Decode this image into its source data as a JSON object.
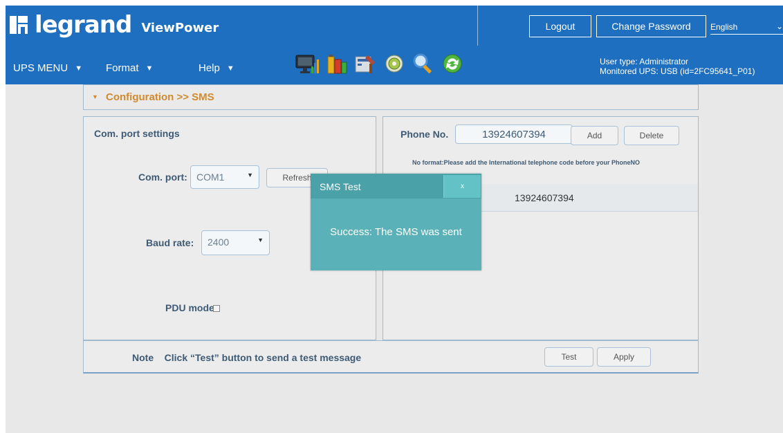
{
  "header": {
    "brand": "legrand",
    "product": "ViewPower",
    "logout_label": "Logout",
    "change_password_label": "Change Password",
    "language": "English",
    "user_type": "User type: Administrator",
    "monitored_ups": "Monitored UPS: USB (id=2FC95641_P01)"
  },
  "menus": [
    {
      "label": "UPS MENU"
    },
    {
      "label": "Format"
    },
    {
      "label": "Help"
    }
  ],
  "toolbar_icons": [
    "monitor-chart-icon",
    "batteries-icon",
    "tools-icon",
    "settings-disc-icon",
    "magnifier-icon",
    "refresh-arrows-icon"
  ],
  "breadcrumb": {
    "text": "Configuration >> SMS"
  },
  "com_settings": {
    "title": "Com. port settings",
    "com_port_label": "Com. port:",
    "com_port_value": "COM1",
    "refresh_label": "Refresh",
    "baud_label": "Baud rate:",
    "baud_value": "2400",
    "pdu_label": "PDU mode"
  },
  "phone": {
    "label": "Phone No.",
    "input_value": "13924607394",
    "add_label": "Add",
    "delete_label": "Delete",
    "format_note": "No format:Please add the International telephone code before your PhoneNO",
    "list": [
      "13924607394"
    ]
  },
  "footer": {
    "note": "Note    Click “Test” button to send a test message",
    "test_label": "Test",
    "apply_label": "Apply"
  },
  "modal": {
    "title": "SMS Test",
    "close_label": "x",
    "message": "Success: The SMS was sent"
  },
  "colors": {
    "header_bg": "#1e6fc0",
    "modal_bg": "#5ab2b8",
    "breadcrumb_text": "#d08a2f"
  }
}
